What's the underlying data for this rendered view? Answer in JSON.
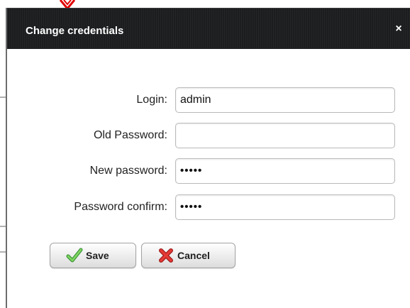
{
  "dialog": {
    "title": "Change credentials",
    "close_label": "×"
  },
  "form": {
    "login": {
      "label": "Login:",
      "value": "admin"
    },
    "old_password": {
      "label": "Old Password:",
      "value": ""
    },
    "new_password": {
      "label": "New password:",
      "value": "•••••"
    },
    "password_confirm": {
      "label": "Password confirm:",
      "value": "•••••"
    }
  },
  "buttons": {
    "save_label": "Save",
    "cancel_label": "Cancel"
  },
  "icons": {
    "save": "checkmark-icon",
    "cancel": "x-mark-icon",
    "annotation": "down-arrow-icon"
  },
  "colors": {
    "header_bg": "#1b1d1f",
    "save_icon": "#4caf50",
    "cancel_icon": "#d32f2f",
    "annotation_arrow": "#e00000"
  }
}
